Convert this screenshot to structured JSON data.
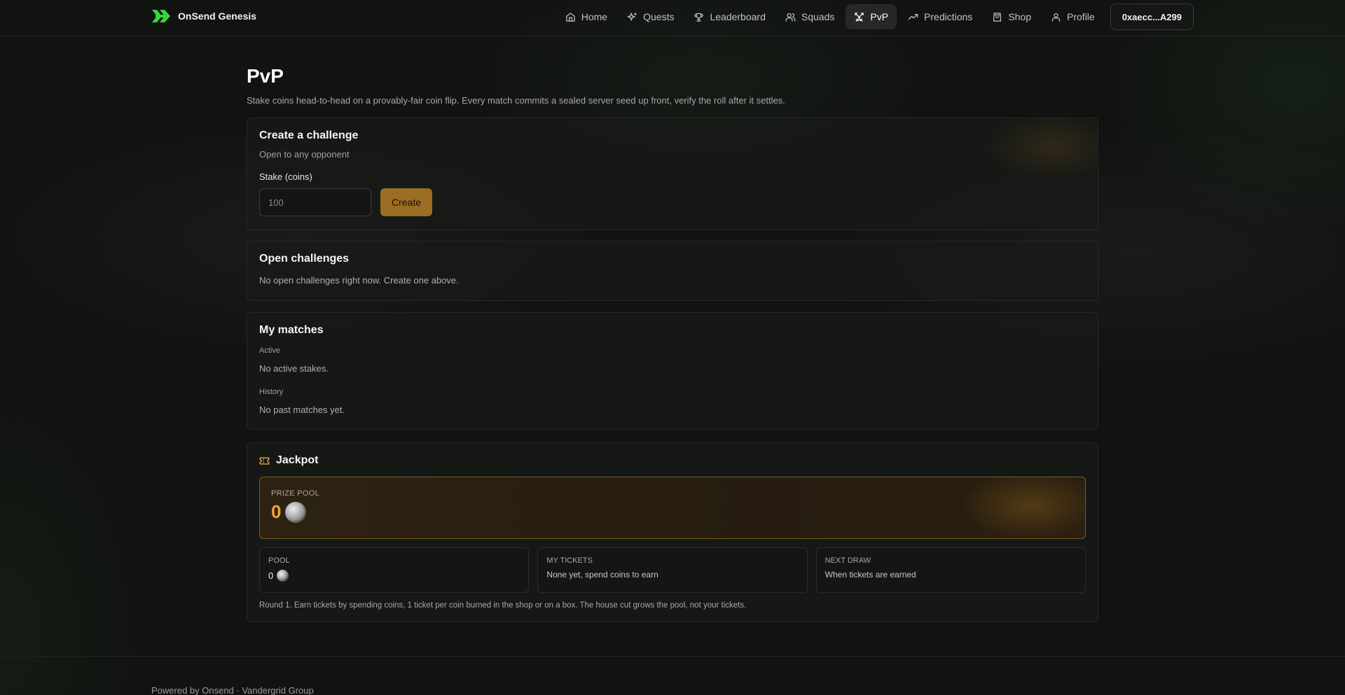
{
  "brand": {
    "name": "OnSend Genesis",
    "logo_icon": "double-chevron-logo-icon",
    "logo_color": "#35d63a"
  },
  "nav": {
    "items": [
      {
        "label": "Home",
        "icon": "home-icon",
        "active": false
      },
      {
        "label": "Quests",
        "icon": "sparkle-icon",
        "active": false
      },
      {
        "label": "Leaderboard",
        "icon": "trophy-icon",
        "active": false
      },
      {
        "label": "Squads",
        "icon": "users-icon",
        "active": false
      },
      {
        "label": "PvP",
        "icon": "swords-icon",
        "active": true
      },
      {
        "label": "Predictions",
        "icon": "trending-up-icon",
        "active": false
      },
      {
        "label": "Shop",
        "icon": "shopping-bag-icon",
        "active": false
      },
      {
        "label": "Profile",
        "icon": "user-icon",
        "active": false
      }
    ],
    "wallet": "0xaecc...A299"
  },
  "page": {
    "title": "PvP",
    "subtitle": "Stake coins head-to-head on a provably-fair coin flip. Every match commits a sealed server seed up front, verify the roll after it settles."
  },
  "create": {
    "title": "Create a challenge",
    "subtitle": "Open to any opponent",
    "stake_label": "Stake (coins)",
    "stake_placeholder": "100",
    "button": "Create",
    "accent": "#9b6d25"
  },
  "open_challenges": {
    "title": "Open challenges",
    "empty": "No open challenges right now. Create one above."
  },
  "matches": {
    "title": "My matches",
    "active_label": "Active",
    "active_empty": "No active stakes.",
    "history_label": "History",
    "history_empty": "No past matches yet."
  },
  "jackpot": {
    "title": "Jackpot",
    "icon": "ticket-icon",
    "prize_label": "PRIZE POOL",
    "prize_value": "0",
    "prize_color": "#f0a632",
    "stats": [
      {
        "label": "POOL",
        "value": "0",
        "has_coin": true
      },
      {
        "label": "MY TICKETS",
        "value": "None yet, spend coins to earn",
        "has_coin": false
      },
      {
        "label": "NEXT DRAW",
        "value": "When tickets are earned",
        "has_coin": false
      }
    ],
    "footnote": "Round 1. Earn tickets by spending coins, 1 ticket per coin burned in the shop or on a box. The house cut grows the pool, not your tickets."
  },
  "footer": {
    "text": "Powered by Onsend · Vandergrid Group"
  }
}
